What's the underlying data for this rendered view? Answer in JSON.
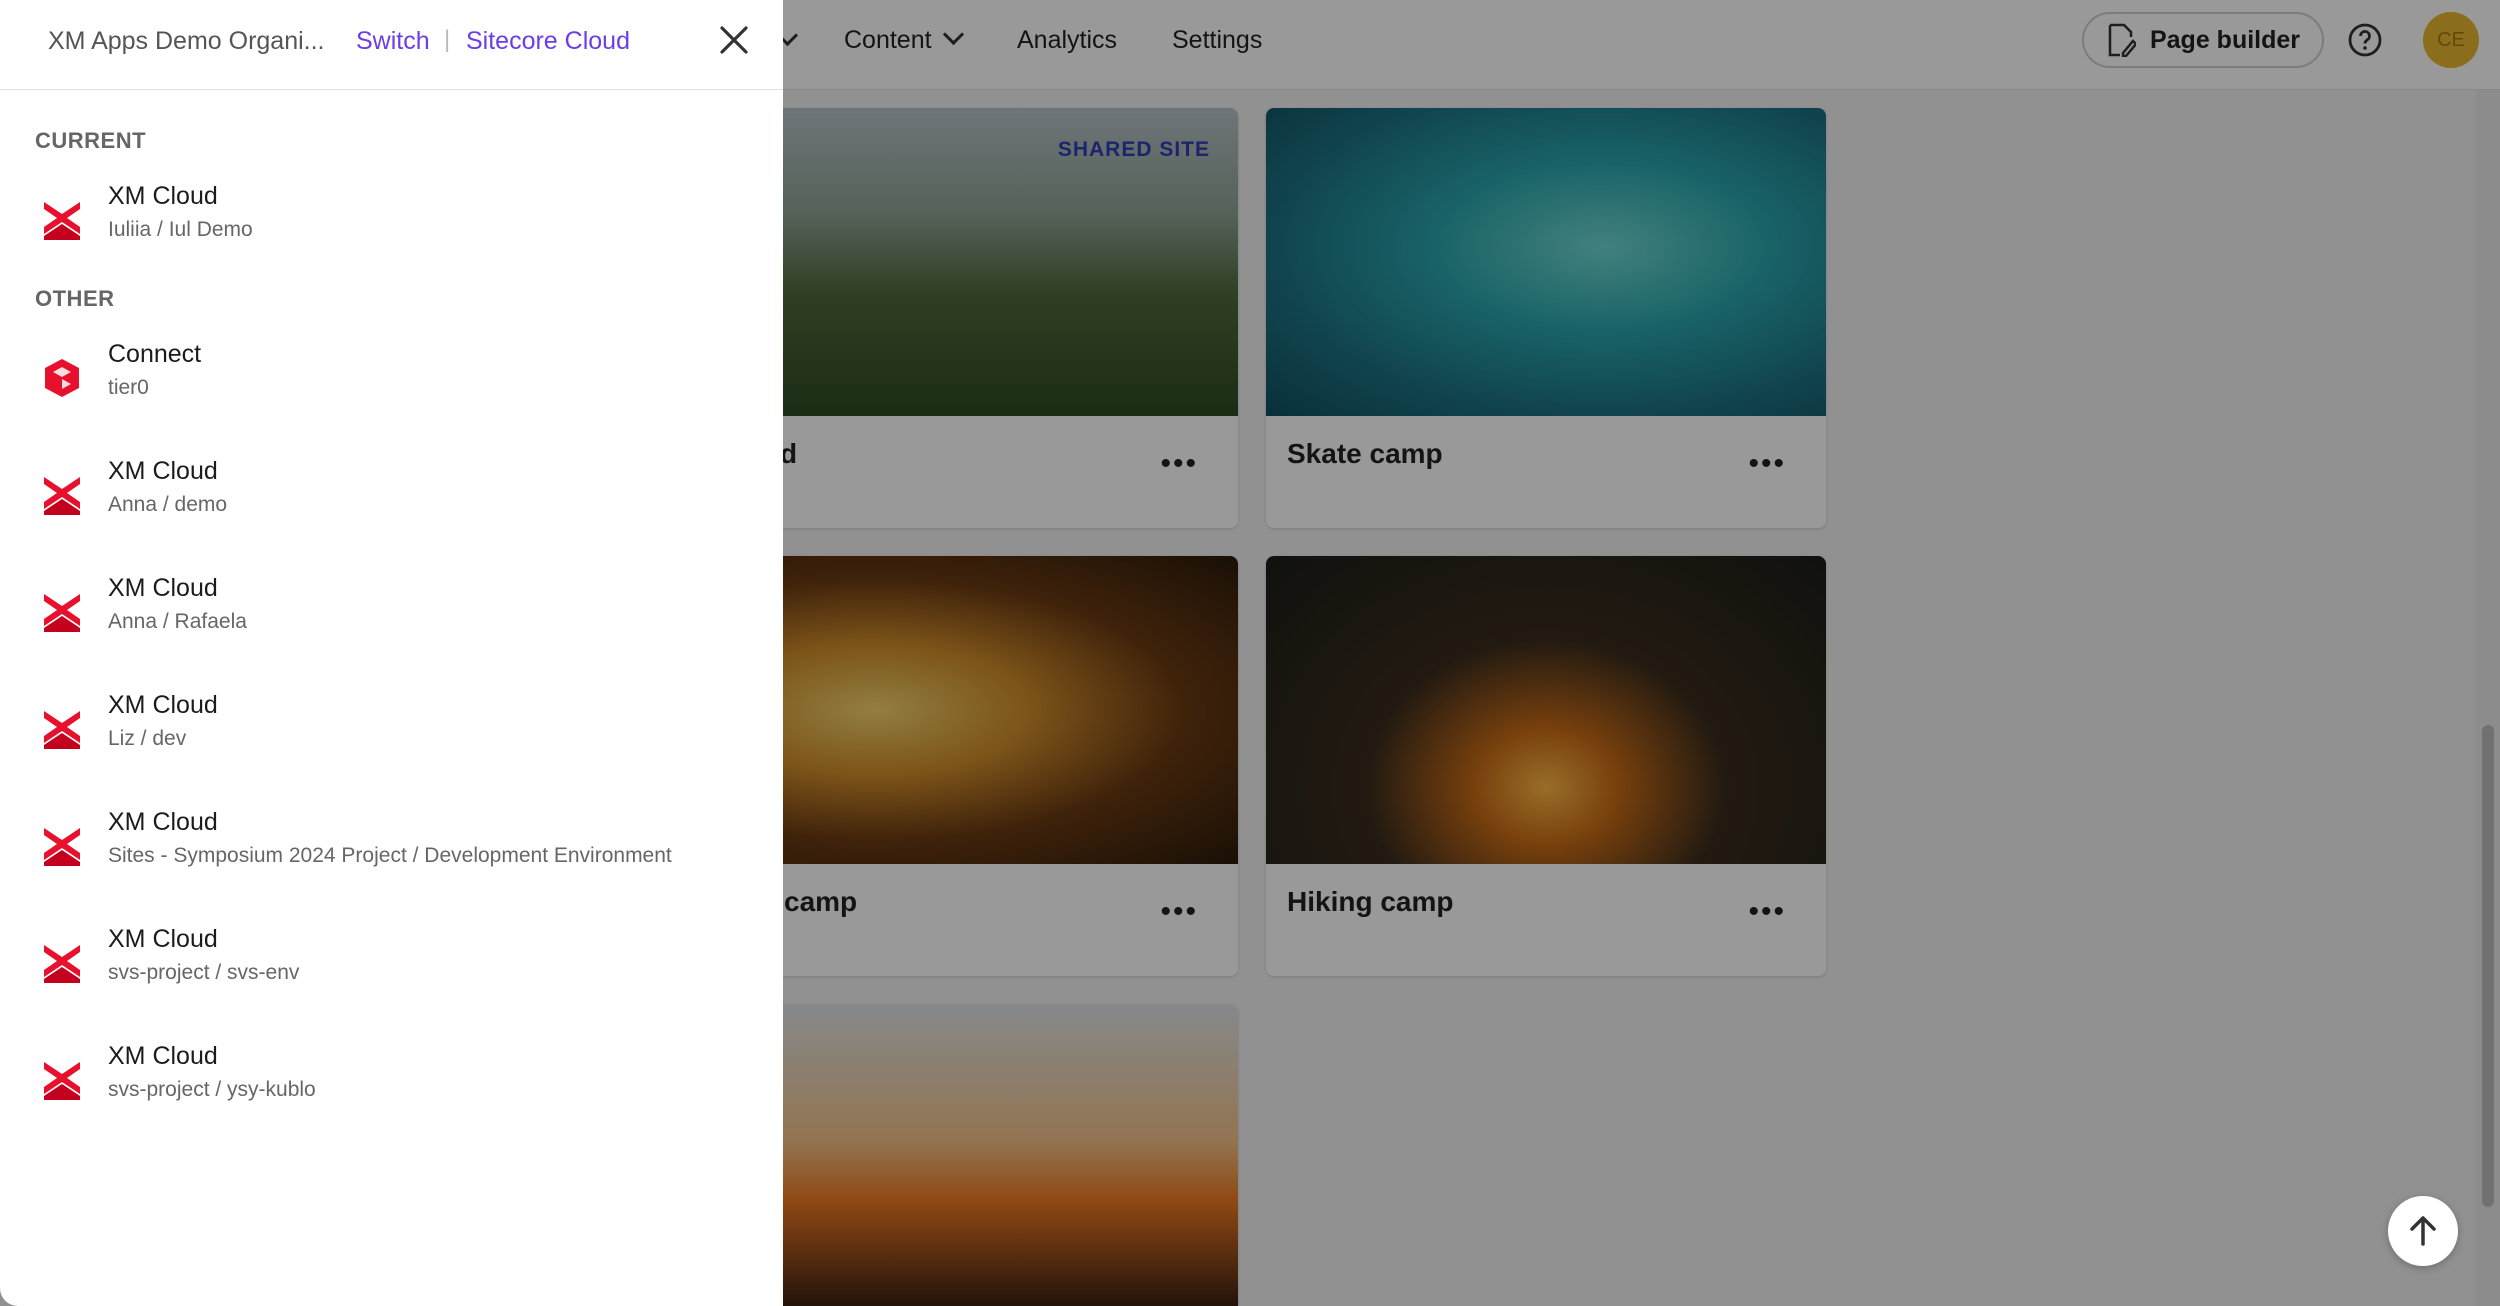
{
  "topbar": {
    "nav": [
      {
        "label": "Content"
      },
      {
        "label": "Analytics"
      },
      {
        "label": "Settings"
      }
    ],
    "page_builder_label": "Page builder",
    "avatar_initials": "CE"
  },
  "cards": [
    {
      "title": "d",
      "badge": "SHARED SITE",
      "more": "•••"
    },
    {
      "title": "Skate camp",
      "more": "•••"
    },
    {
      "title": "camp",
      "more": "•••"
    },
    {
      "title": "Hiking camp",
      "more": "•••"
    }
  ],
  "drawer": {
    "org_name": "XM Apps Demo Organi...",
    "switch_label": "Switch",
    "separator": "|",
    "cloud_label": "Sitecore Cloud",
    "current_label": "CURRENT",
    "other_label": "OTHER",
    "current": {
      "icon": "xm-cloud-logo-icon",
      "name": "XM Cloud",
      "sub": "Iuliia / Iul Demo"
    },
    "other": [
      {
        "icon": "connect-logo-icon",
        "name": "Connect",
        "sub": "tier0"
      },
      {
        "icon": "xm-cloud-logo-icon",
        "name": "XM Cloud",
        "sub": "Anna / demo"
      },
      {
        "icon": "xm-cloud-logo-icon",
        "name": "XM Cloud",
        "sub": "Anna / Rafaela"
      },
      {
        "icon": "xm-cloud-logo-icon",
        "name": "XM Cloud",
        "sub": "Liz / dev"
      },
      {
        "icon": "xm-cloud-logo-icon",
        "name": "XM Cloud",
        "sub": "Sites - Symposium 2024 Project / Development Environment"
      },
      {
        "icon": "xm-cloud-logo-icon",
        "name": "XM Cloud",
        "sub": "svs-project / svs-env"
      },
      {
        "icon": "xm-cloud-logo-icon",
        "name": "XM Cloud",
        "sub": "svs-project / ysy-kublo"
      }
    ]
  },
  "colors": {
    "accent_link": "#6b3ee8",
    "brand_red": "#e8112d",
    "badge_blue": "#2f3fb5",
    "avatar": "#e6b72d"
  }
}
